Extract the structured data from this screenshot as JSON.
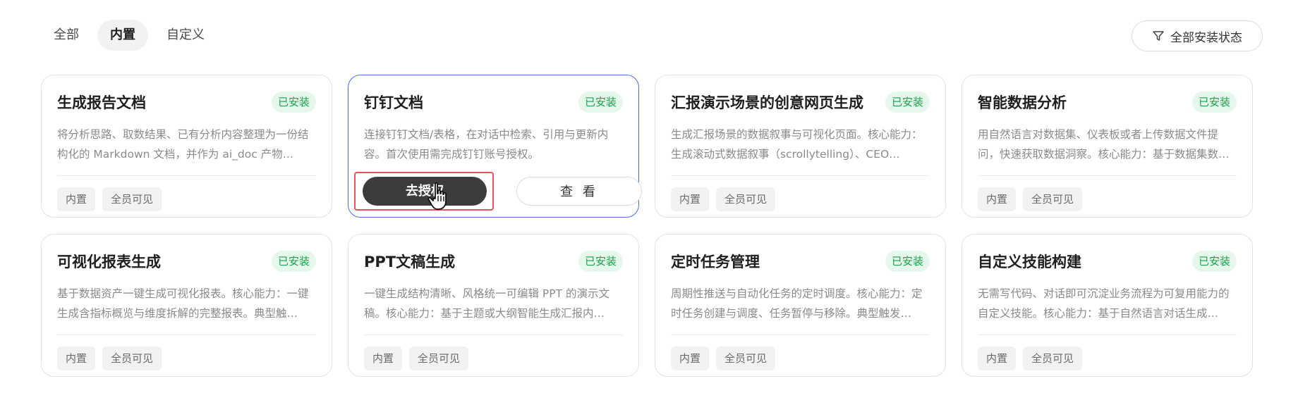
{
  "tabs": [
    {
      "label": "全部",
      "active": false
    },
    {
      "label": "内置",
      "active": true
    },
    {
      "label": "自定义",
      "active": false
    }
  ],
  "filter": {
    "label": "全部安装状态",
    "icon": "filter-icon"
  },
  "cards": [
    {
      "title": "生成报告文档",
      "badge": "已安装",
      "desc": "将分析思路、取数结果、已有分析内容整理为一份结构化的 Markdown 文档，并作为 ai_doc 产物…",
      "tags": [
        "内置",
        "全员可见"
      ]
    },
    {
      "title": "钉钉文档",
      "badge": "已安装",
      "desc": "连接钉钉文档/表格，在对话中检索、引用与更新内容。首次使用需完成钉钉账号授权。",
      "tags": [],
      "selected": true,
      "primary_action": "去授权",
      "secondary_action": "查 看"
    },
    {
      "title": "汇报演示场景的创意网页生成",
      "badge": "已安装",
      "desc": "生成汇报场景的数据叙事与可视化页面。核心能力：生成滚动式数据叙事（scrollytelling）、CEO…",
      "tags": [
        "内置",
        "全员可见"
      ]
    },
    {
      "title": "智能数据分析",
      "badge": "已安装",
      "desc": "用自然语言对数据集、仪表板或者上传数据文件提问，快速获取数据洞察。核心能力：基于数据集数…",
      "tags": [
        "内置",
        "全员可见"
      ]
    },
    {
      "title": "可视化报表生成",
      "badge": "已安装",
      "desc": "基于数据资产一键生成可视化报表。核心能力：一键生成含指标概览与维度拆解的完整报表。典型触…",
      "tags": [
        "内置",
        "全员可见"
      ]
    },
    {
      "title": "PPT文稿生成",
      "badge": "已安装",
      "desc": "一键生成结构清晰、风格统一可编辑 PPT 的演示文稿。核心能力：基于主题或大纲智能生成汇报内…",
      "tags": [
        "内置",
        "全员可见"
      ]
    },
    {
      "title": "定时任务管理",
      "badge": "已安装",
      "desc": "周期性推送与自动化任务的定时调度。核心能力：定时任务创建与调度、任务暂停与移除。典型触发…",
      "tags": [
        "内置",
        "全员可见"
      ]
    },
    {
      "title": "自定义技能构建",
      "badge": "已安装",
      "desc": "无需写代码、对话即可沉淀业务流程为可复用能力的自定义技能。核心能力：基于自然语言对话生成…",
      "tags": [
        "内置",
        "全员可见"
      ]
    }
  ],
  "colors": {
    "accent": "#4d6ef0",
    "installed": "#17a34a",
    "highlight": "#e8525a",
    "primary_button": "#3c3c3c"
  }
}
